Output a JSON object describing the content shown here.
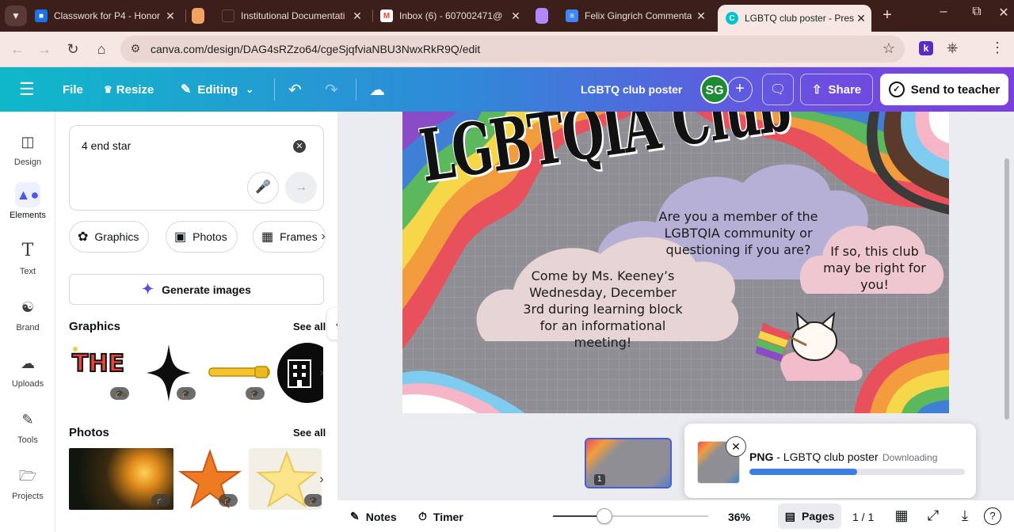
{
  "browser": {
    "tabs": [
      {
        "title": "Classwork for P4 - Honor",
        "favicon_color": "#1a73e8"
      },
      {
        "title": "",
        "favicon_color": "#f4a261"
      },
      {
        "title": "Institutional Documentati",
        "favicon_color": "#3c1f1b"
      },
      {
        "title": "Inbox (6) - 607002471@",
        "favicon_color": "#ea4335"
      },
      {
        "title": "",
        "favicon_color": "#b388ff"
      },
      {
        "title": "Felix Gingrich Commenta",
        "favicon_color": "#4285f4"
      },
      {
        "title": "LGBTQ club poster - Pres",
        "favicon_color": "#00c4cc",
        "active": true
      }
    ],
    "url": "canva.com/design/DAG4sRZzo64/cgeSjqfviaNBU3NwxRkR9Q/edit",
    "extension_k": "k"
  },
  "topbar": {
    "file": "File",
    "resize": "Resize",
    "mode": "Editing",
    "design_title": "LGBTQ club poster",
    "avatar_initials": "SG",
    "share": "Share",
    "send_to_teacher": "Send to teacher"
  },
  "rail": [
    {
      "label": "Design",
      "icon": "design-icon"
    },
    {
      "label": "Elements",
      "icon": "elements-icon",
      "active": true
    },
    {
      "label": "Text",
      "icon": "text-icon"
    },
    {
      "label": "Brand",
      "icon": "brand-icon"
    },
    {
      "label": "Uploads",
      "icon": "uploads-icon"
    },
    {
      "label": "Tools",
      "icon": "tools-icon"
    },
    {
      "label": "Projects",
      "icon": "projects-icon"
    }
  ],
  "panel": {
    "search_value": "4 end star",
    "chips": [
      "Graphics",
      "Photos",
      "Frames"
    ],
    "generate_images": "Generate images",
    "graphics_title": "Graphics",
    "photos_title": "Photos",
    "see_all": "See all",
    "graphic_the_end_text": "THE END"
  },
  "poster": {
    "title": "LGBTQIA Club",
    "cloud_main": "Are you a member of the LGBTQIA community or questioning if you are?",
    "cloud_left": "Come by Ms. Keeney’s Wednesday, December 3rd during learning block for an informational meeting!",
    "cloud_right": "If so, this club may be right for you!"
  },
  "download_toast": {
    "format": "PNG",
    "name": " - LGBTQ club poster",
    "status": "Downloading",
    "progress": 0.5
  },
  "page_thumb_number": "1",
  "bottombar": {
    "notes": "Notes",
    "timer": "Timer",
    "zoom": "36%",
    "zoom_fraction": 0.33,
    "pages": "Pages",
    "page_count": "1 / 1"
  },
  "colors": {
    "accent": "#4a5be0",
    "topbar_start": "#0fb8c9",
    "topbar_end": "#7d3ee0",
    "avatar": "#1f8a35"
  }
}
